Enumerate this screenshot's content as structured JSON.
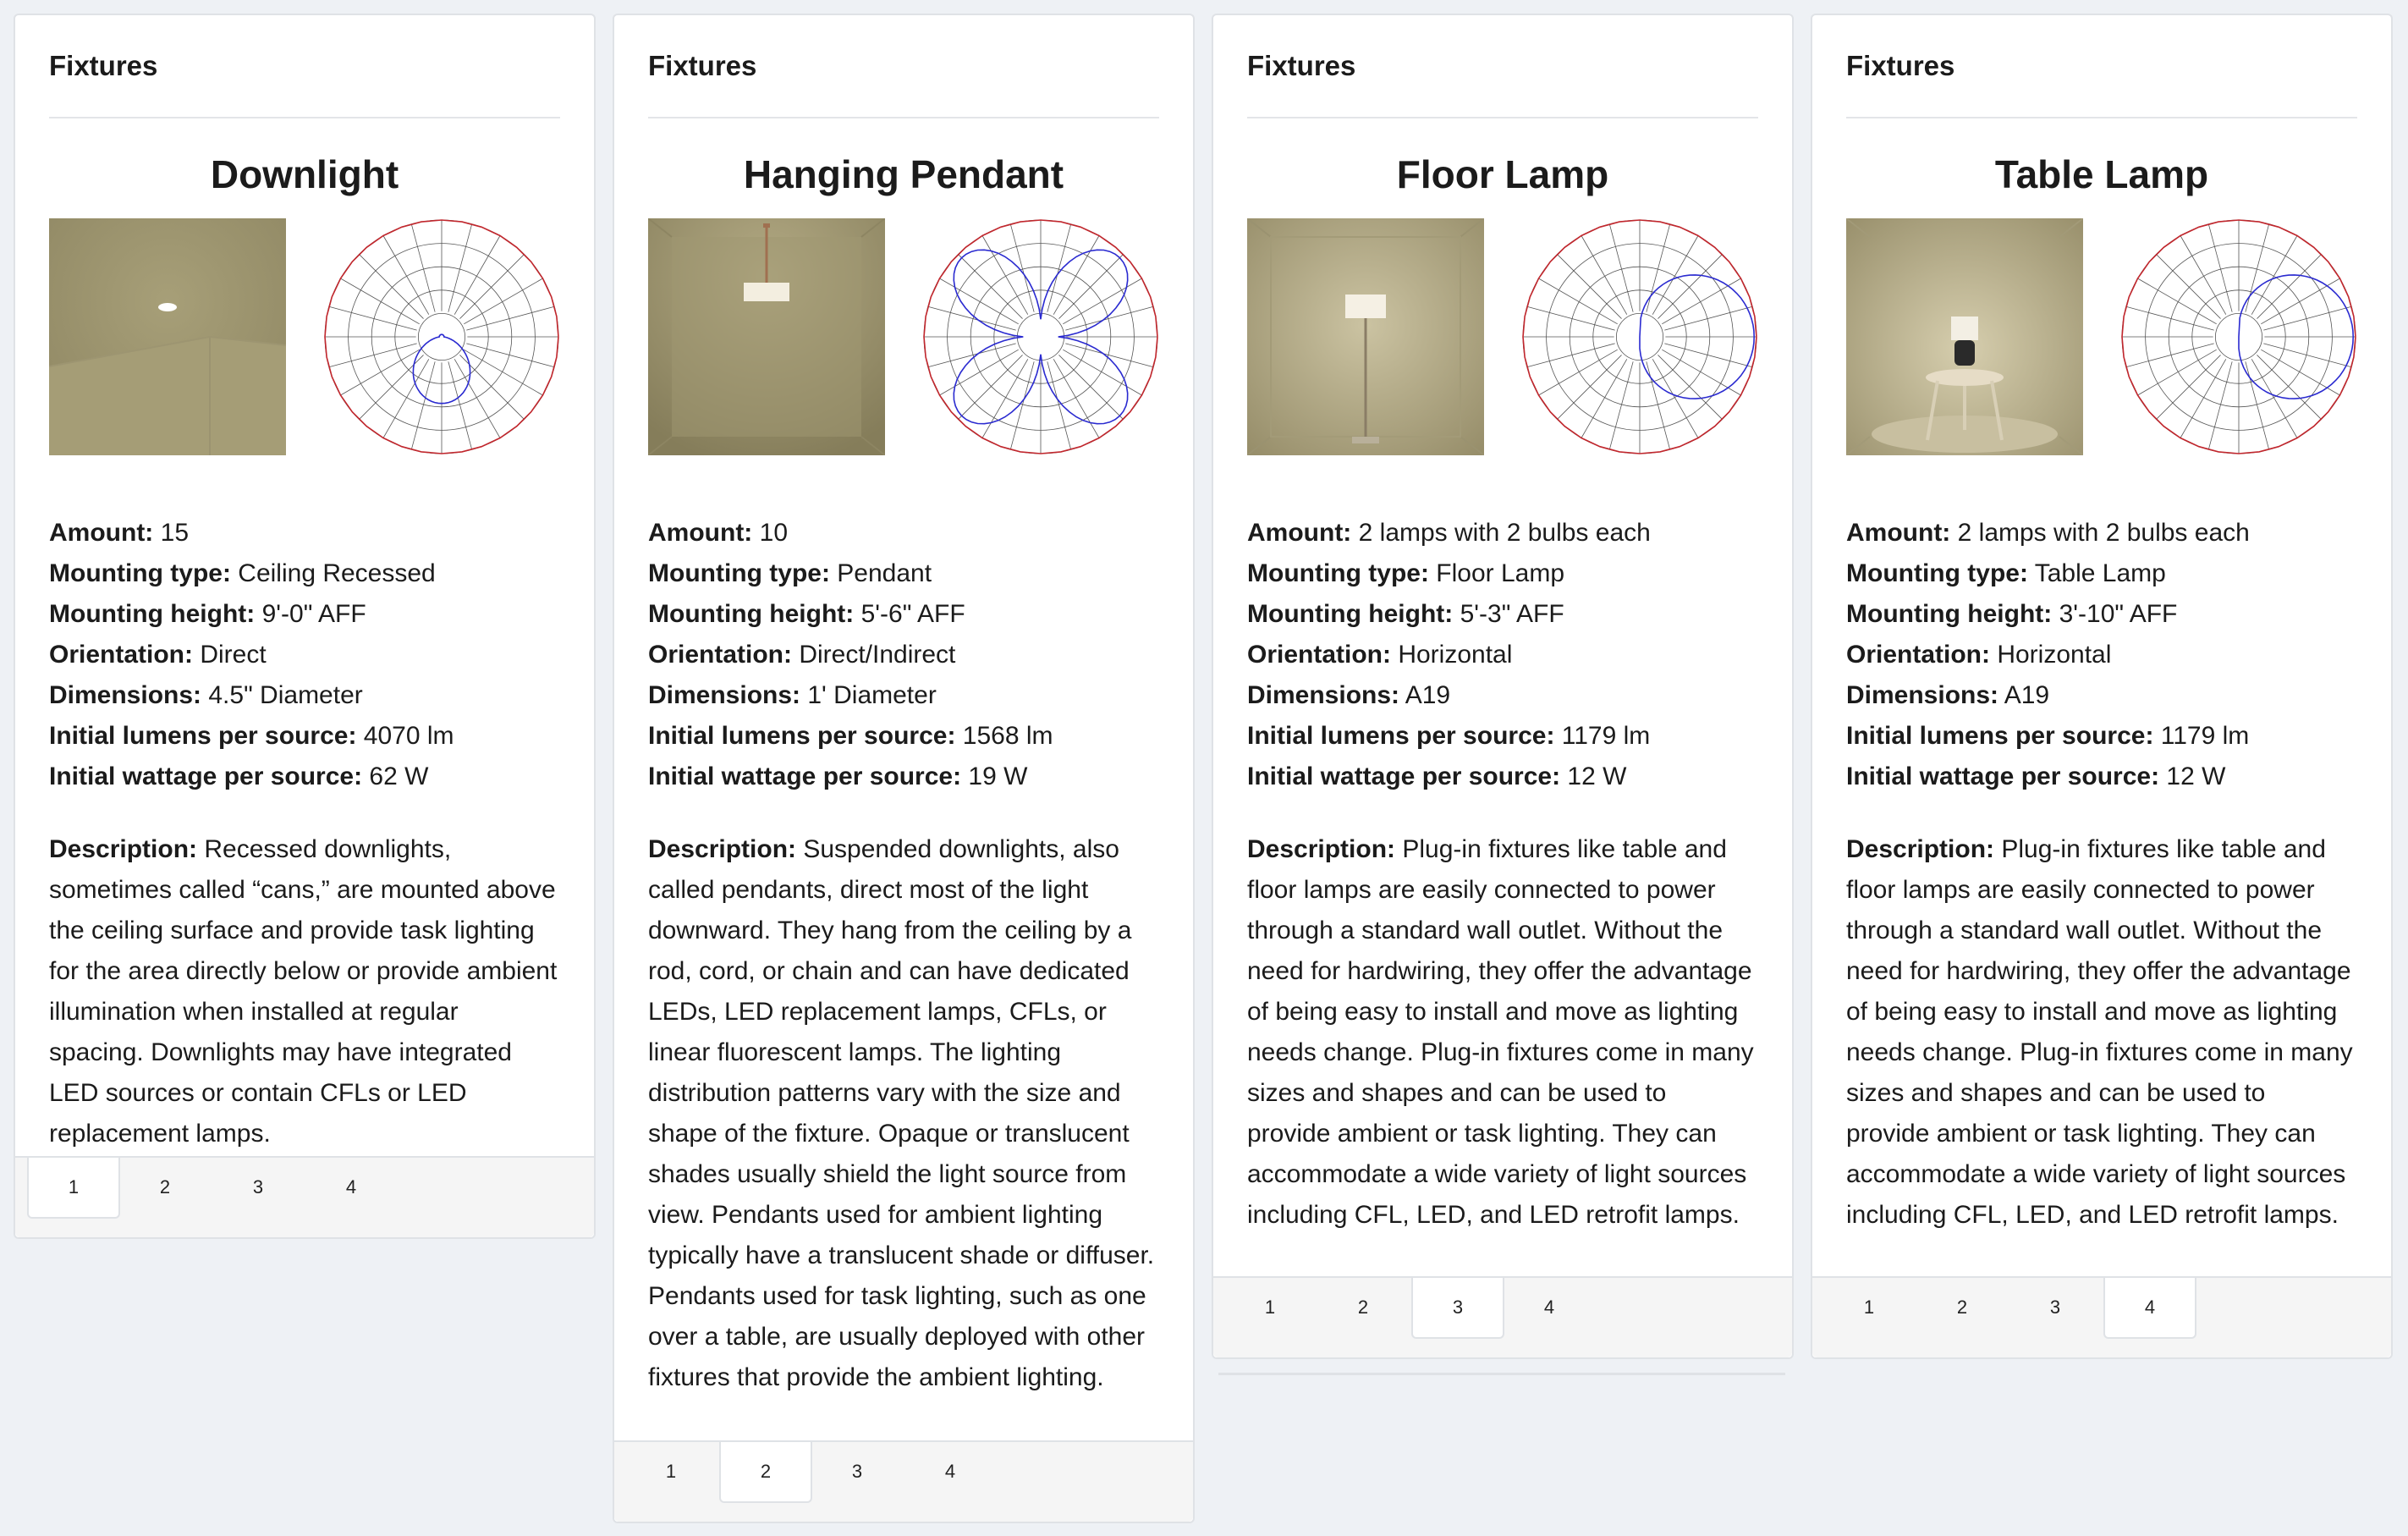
{
  "cards": [
    {
      "header": "Fixtures",
      "title": "Downlight",
      "specs": [
        {
          "label": "Amount:",
          "value": " 15"
        },
        {
          "label": "Mounting type:",
          "value": " Ceiling Recessed"
        },
        {
          "label": "Mounting height:",
          "value": " 9'-0\" AFF"
        },
        {
          "label": "Orientation:",
          "value": " Direct"
        },
        {
          "label": "Dimensions:",
          "value": " 4.5\" Diameter"
        },
        {
          "label": "Initial lumens per source:",
          "value": " 4070 lm"
        },
        {
          "label": "Initial wattage per source:",
          "value": " 62 W"
        }
      ],
      "description_label": "Description:",
      "description": " Recessed downlights, sometimes called “cans,” are mounted above the ceiling surface and provide task lighting for the area directly below or provide ambient illumination when installed at regular spacing. Downlights may have integrated LED sources or contain CFLs or LED replacement lamps.",
      "tabs": [
        "1",
        "2",
        "3",
        "4"
      ],
      "active_tab": "1"
    },
    {
      "header": "Fixtures",
      "title": "Hanging Pendant",
      "specs": [
        {
          "label": "Amount:",
          "value": " 10"
        },
        {
          "label": "Mounting type:",
          "value": " Pendant"
        },
        {
          "label": "Mounting height:",
          "value": " 5'-6\" AFF"
        },
        {
          "label": "Orientation:",
          "value": " Direct/Indirect"
        },
        {
          "label": "Dimensions:",
          "value": " 1' Diameter"
        },
        {
          "label": "Initial lumens per source:",
          "value": " 1568 lm"
        },
        {
          "label": "Initial wattage per source:",
          "value": " 19 W"
        }
      ],
      "description_label": "Description:",
      "description": " Suspended downlights, also called pendants, direct most of the light downward. They hang from the ceiling by a rod, cord, or chain and can have dedicated LEDs, LED replacement lamps, CFLs, or linear fluorescent lamps.  The lighting distribution patterns vary with the size and shape of the fixture. Opaque or translucent shades usually shield the light source from view. Pendants used for ambient lighting typically have a translucent shade or diffuser. Pendants used for task lighting, such as one over a table, are usually deployed with other fixtures that provide the ambient lighting.",
      "tabs": [
        "1",
        "2",
        "3",
        "4"
      ],
      "active_tab": "2"
    },
    {
      "header": "Fixtures",
      "title": "Floor Lamp",
      "specs": [
        {
          "label": "Amount:",
          "value": " 2 lamps with 2 bulbs each"
        },
        {
          "label": "Mounting type:",
          "value": " Floor Lamp"
        },
        {
          "label": "Mounting height:",
          "value": " 5'-3\" AFF"
        },
        {
          "label": "Orientation:",
          "value": " Horizontal"
        },
        {
          "label": "Dimensions:",
          "value": " A19"
        },
        {
          "label": "Initial lumens per source:",
          "value": " 1179 lm"
        },
        {
          "label": "Initial wattage per source:",
          "value": " 12 W"
        }
      ],
      "description_label": "Description:",
      "description": " Plug-in fixtures like table and floor lamps are easily connected to power through a standard wall outlet. Without the need for hardwiring, they offer the advantage of being easy to install and move as lighting needs change. Plug-in fixtures come in many sizes and shapes and can be used to provide ambient or task lighting. They can accommodate a wide variety of light sources including CFL, LED, and LED retrofit lamps.",
      "tabs": [
        "1",
        "2",
        "3",
        "4"
      ],
      "active_tab": "3"
    },
    {
      "header": "Fixtures",
      "title": "Table Lamp",
      "specs": [
        {
          "label": "Amount:",
          "value": " 2 lamps with 2 bulbs each"
        },
        {
          "label": "Mounting type:",
          "value": " Table Lamp"
        },
        {
          "label": "Mounting height:",
          "value": " 3'-10\" AFF"
        },
        {
          "label": "Orientation:",
          "value": " Horizontal"
        },
        {
          "label": "Dimensions:",
          "value": " A19"
        },
        {
          "label": "Initial lumens per source:",
          "value": " 1179 lm"
        },
        {
          "label": "Initial wattage per source:",
          "value": " 12 W"
        }
      ],
      "description_label": "Description:",
      "description": " Plug-in fixtures like table and floor lamps are easily connected to power through a standard wall outlet. Without the need for hardwiring, they offer the advantage of being easy to install and move as lighting needs change. Plug-in fixtures come in many sizes and shapes and can be used to provide ambient or task lighting. They can accommodate a wide variety of light sources including CFL, LED, and LED retrofit lamps.",
      "tabs": [
        "1",
        "2",
        "3",
        "4"
      ],
      "active_tab": "4"
    }
  ],
  "colors": {
    "room_wall": "#a39a74",
    "polar_outline": "#c1272d",
    "polar_curve": "#2a2ad0",
    "polar_grid": "#555555"
  }
}
